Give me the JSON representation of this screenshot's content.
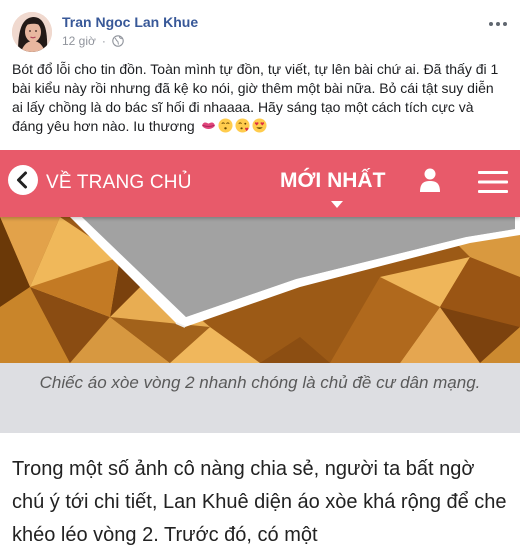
{
  "post": {
    "author": "Tran Ngoc Lan Khue",
    "time": "12 giờ",
    "more_icon": "more-horizontal-icon",
    "privacy_icon": "globe-icon",
    "text": "Bót đổ lỗi cho tin đồn. Toàn mình tự đồn, tự viết, tự lên bài chứ ai. Đã thấy đi 1 bài kiểu này rồi nhưng đã kệ ko nói, giờ thêm một bài nữa. Bỏ cái tật suy diễn ai lấy chồng là do bác sĩ hối đi nhaaaa. Hãy sáng tạo một cách tích cực và đáng yêu hơn nào. Iu thương",
    "emojis": [
      "kiss-lips-icon",
      "kissing-smiling-eyes-icon",
      "face-blowing-kiss-icon",
      "heart-eyes-icon"
    ]
  },
  "card": {
    "nav_color": "#e85a6a",
    "back_label": "VỀ TRANG CHỦ",
    "newest_label": "MỚI NHẤT",
    "caption": "Chiếc áo xòe vòng 2 nhanh chóng là chủ đề cư dân mạng.",
    "body": "Trong một số ảnh cô nàng chia sẻ, người ta bất ngờ chú ý tới chi tiết, Lan Khuê diện áo xòe khá rộng để che khéo léo vòng 2. Trước đó, có một"
  }
}
